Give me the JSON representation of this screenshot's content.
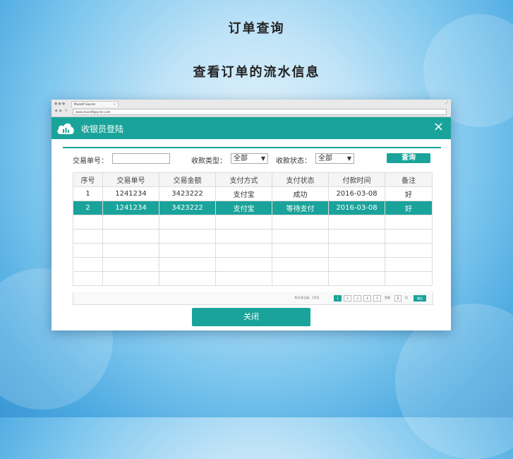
{
  "banner": {
    "title": "订单查询",
    "subtitle": "查看订单的流水信息"
  },
  "browser": {
    "tab_title": "Musahf Gayran",
    "url": "www.musahfgayran.com"
  },
  "dialog": {
    "title": "收银员登陆",
    "close_icon": "×",
    "close_button": "关闭"
  },
  "filters": {
    "order_no_label": "交易单号：",
    "pay_type_label": "收款类型：",
    "pay_type_value": "全部",
    "pay_status_label": "收款状态：",
    "pay_status_value": "全部",
    "query_button": "查询"
  },
  "table": {
    "headers": [
      "序号",
      "交易单号",
      "交易金额",
      "支付方式",
      "支付状态",
      "付款时间",
      "备注"
    ],
    "rows": [
      [
        "1",
        "1241234",
        "3423222",
        "支付宝",
        "成功",
        "2016-03-08",
        "好"
      ],
      [
        "2",
        "1241234",
        "3423222",
        "支付宝",
        "等待支付",
        "2016-03-08",
        "好"
      ]
    ],
    "selected_row": 2
  },
  "pager": {
    "info": "共21条记录，1/5页",
    "pages": [
      "1",
      "2",
      "3",
      "4",
      "5"
    ],
    "active_page": "1",
    "jump_label": "到第",
    "jump_value": "5",
    "jump_suffix": "页",
    "jump_button": "确定"
  },
  "colors": {
    "accent": "#1aa39a"
  }
}
